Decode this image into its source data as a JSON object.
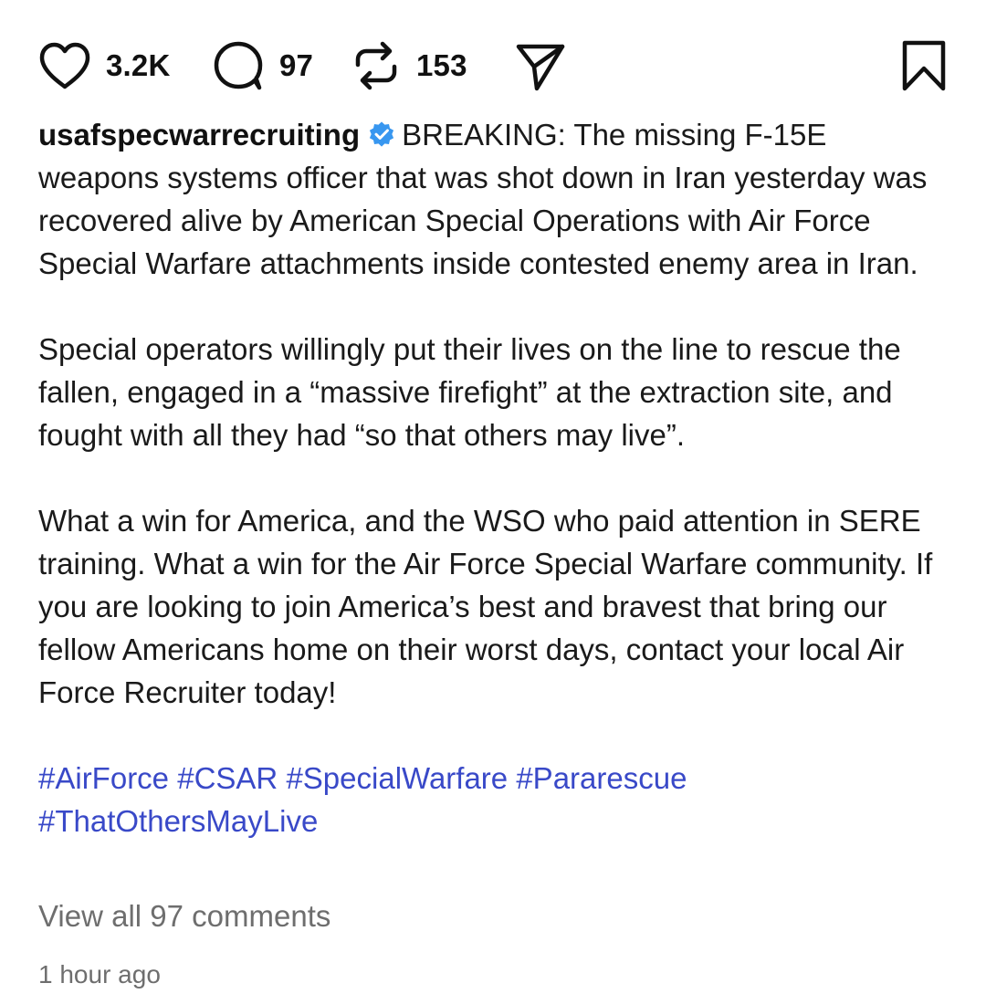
{
  "actions": {
    "like_count": "3.2K",
    "comment_count": "97",
    "repost_count": "153"
  },
  "post": {
    "username": "usafspecwarrecruiting",
    "paragraph1": "BREAKING: The missing F-15E weapons systems officer that was shot down in Iran yesterday was recovered alive by American Special Operations with Air Force Special Warfare attachments inside contested enemy area in Iran.",
    "paragraph2": "Special operators willingly put their lives on the line to rescue the fallen, engaged in a “massive firefight” at the extraction site, and fought with all they had “so that others may live”.",
    "paragraph3": "What a win for America, and the WSO who paid attention in SERE training. What a win for the Air Force Special Warfare community. If you are looking to join America’s best and bravest that bring our fellow Americans home on their worst days, contact your local Air Force Recruiter today!",
    "hashtags": [
      "#AirForce",
      "#CSAR",
      "#SpecialWarfare",
      "#Pararescue",
      "#ThatOthersMayLive"
    ]
  },
  "footer": {
    "view_comments": "View all 97 comments",
    "timestamp": "1 hour ago"
  },
  "colors": {
    "text": "#1a1a1a",
    "hashtag": "#3949c8",
    "muted": "#6e6e6e",
    "verified": "#3897f0"
  },
  "icons": {
    "like": "heart-icon",
    "comment": "comment-bubble-icon",
    "repost": "repost-arrows-icon",
    "share": "send-paper-plane-icon",
    "save": "bookmark-icon",
    "verified": "verified-badge-icon"
  }
}
